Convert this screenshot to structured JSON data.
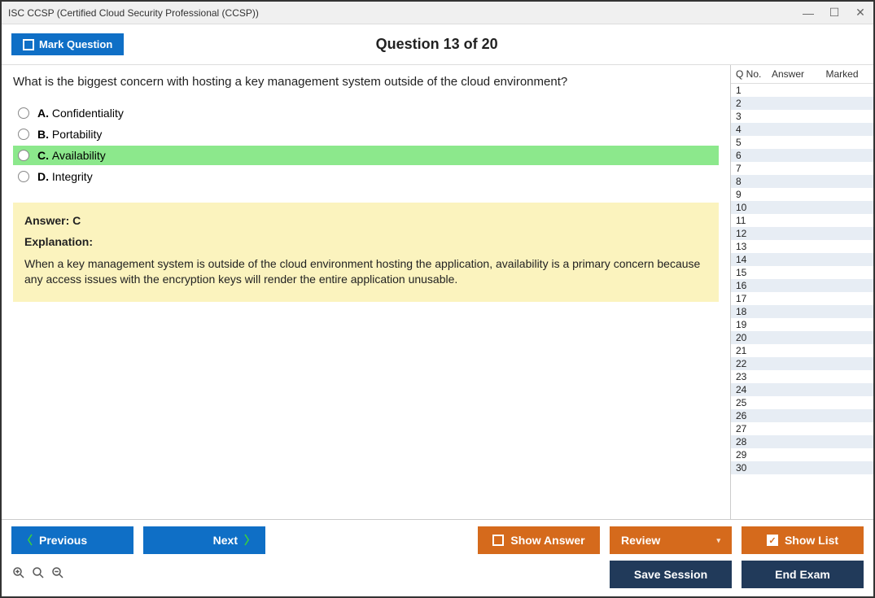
{
  "window": {
    "title": "ISC CCSP (Certified Cloud Security Professional (CCSP))"
  },
  "header": {
    "mark_label": "Mark Question",
    "question_counter": "Question 13 of 20"
  },
  "question": {
    "text": "What is the biggest concern with hosting a key management system outside of the cloud environment?",
    "choices": [
      {
        "letter": "A.",
        "text": "Confidentiality",
        "correct": false
      },
      {
        "letter": "B.",
        "text": "Portability",
        "correct": false
      },
      {
        "letter": "C.",
        "text": "Availability",
        "correct": true
      },
      {
        "letter": "D.",
        "text": "Integrity",
        "correct": false
      }
    ],
    "answer_label": "Answer: C",
    "explanation_label": "Explanation:",
    "explanation_text": "When a key management system is outside of the cloud environment hosting the application, availability is a primary concern because any access issues with the encryption keys will render the entire application unusable."
  },
  "sidepanel": {
    "col_qno": "Q No.",
    "col_answer": "Answer",
    "col_marked": "Marked",
    "rows": [
      {
        "q": "1"
      },
      {
        "q": "2"
      },
      {
        "q": "3"
      },
      {
        "q": "4"
      },
      {
        "q": "5"
      },
      {
        "q": "6"
      },
      {
        "q": "7"
      },
      {
        "q": "8"
      },
      {
        "q": "9"
      },
      {
        "q": "10"
      },
      {
        "q": "11"
      },
      {
        "q": "12"
      },
      {
        "q": "13"
      },
      {
        "q": "14"
      },
      {
        "q": "15"
      },
      {
        "q": "16"
      },
      {
        "q": "17"
      },
      {
        "q": "18"
      },
      {
        "q": "19"
      },
      {
        "q": "20"
      },
      {
        "q": "21"
      },
      {
        "q": "22"
      },
      {
        "q": "23"
      },
      {
        "q": "24"
      },
      {
        "q": "25"
      },
      {
        "q": "26"
      },
      {
        "q": "27"
      },
      {
        "q": "28"
      },
      {
        "q": "29"
      },
      {
        "q": "30"
      }
    ]
  },
  "footer": {
    "previous": "Previous",
    "next": "Next",
    "show_answer": "Show Answer",
    "review": "Review",
    "show_list": "Show List",
    "save_session": "Save Session",
    "end_exam": "End Exam"
  }
}
